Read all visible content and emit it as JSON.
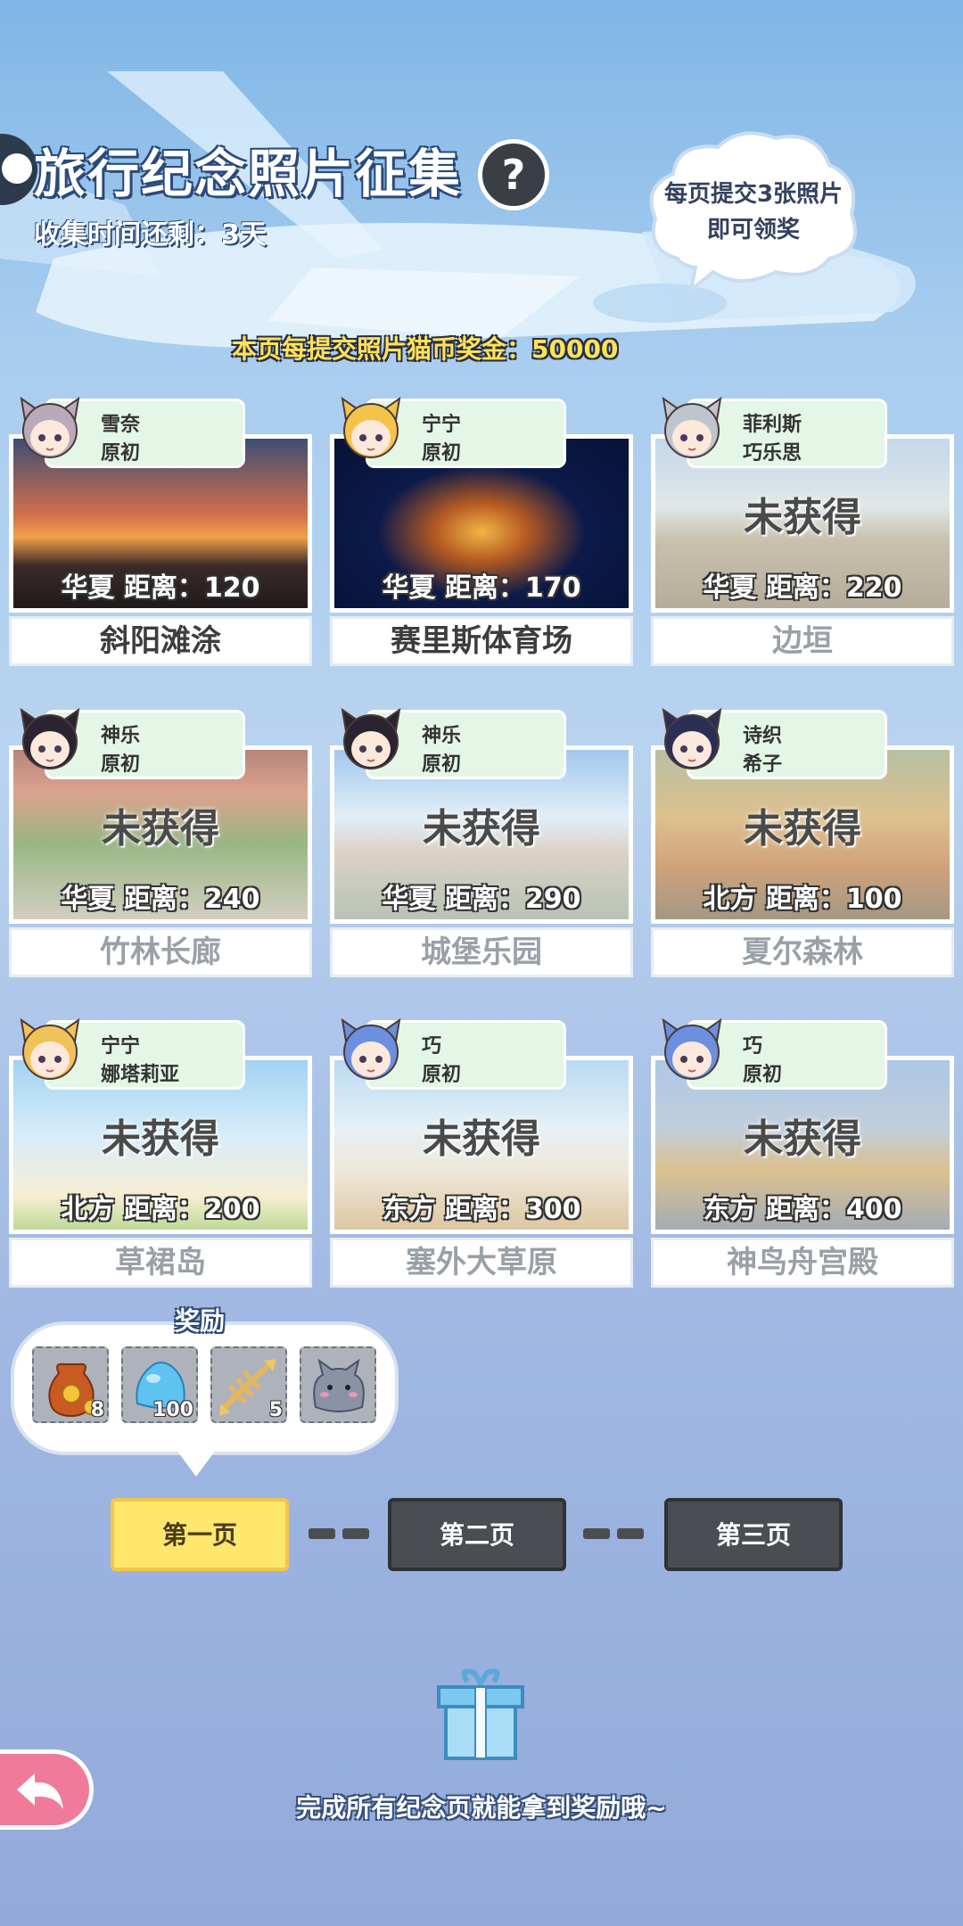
{
  "header": {
    "title": "旅行纪念照片征集",
    "help_icon": "?",
    "timer": "收集时间还剩：3天",
    "tip": [
      "每页提交3张照片",
      "即可领奖"
    ],
    "prize": "本页每提交照片猫币奖金：50000"
  },
  "cards": [
    {
      "name": "斜阳滩涂",
      "tag1": "雪奈",
      "tag2": "原初",
      "distance": "华夏  距离：120",
      "locked": false
    },
    {
      "name": "赛里斯体育场",
      "tag1": "宁宁",
      "tag2": "原初",
      "distance": "华夏  距离：170",
      "locked": false
    },
    {
      "name": "边垣",
      "tag1": "菲利斯",
      "tag2": "巧乐思",
      "distance": "华夏  距离：220",
      "locked": true
    },
    {
      "name": "竹林长廊",
      "tag1": "神乐",
      "tag2": "原初",
      "distance": "华夏  距离：240",
      "locked": true
    },
    {
      "name": "城堡乐园",
      "tag1": "神乐",
      "tag2": "原初",
      "distance": "华夏  距离：290",
      "locked": true
    },
    {
      "name": "夏尔森林",
      "tag1": "诗织",
      "tag2": "希子",
      "distance": "北方  距离：100",
      "locked": true
    },
    {
      "name": "草裙岛",
      "tag1": "宁宁",
      "tag2": "娜塔莉亚",
      "distance": "北方  距离：200",
      "locked": true
    },
    {
      "name": "塞外大草原",
      "tag1": "巧",
      "tag2": "原初",
      "distance": "东方  距离：300",
      "locked": true
    },
    {
      "name": "神鸟舟宫殿",
      "tag1": "巧",
      "tag2": "原初",
      "distance": "东方  距离：400",
      "locked": true
    }
  ],
  "locked_label": "未获得",
  "rewards": {
    "label": "奖励",
    "items": [
      {
        "icon": "coin-bag-icon",
        "count": "8"
      },
      {
        "icon": "blue-slime-icon",
        "count": "100"
      },
      {
        "icon": "fish-bone-icon",
        "count": "5"
      },
      {
        "icon": "gray-cat-icon",
        "count": ""
      }
    ]
  },
  "pages": [
    {
      "label": "第一页",
      "active": true
    },
    {
      "label": "第二页",
      "active": false
    },
    {
      "label": "第三页",
      "active": false
    }
  ],
  "footer": "完成所有纪念页就能拿到奖励哦~",
  "colors": {
    "accent_yellow": "#ffe66d",
    "back_pink": "#f07a9a",
    "tag_green": "#e4f6e6"
  }
}
